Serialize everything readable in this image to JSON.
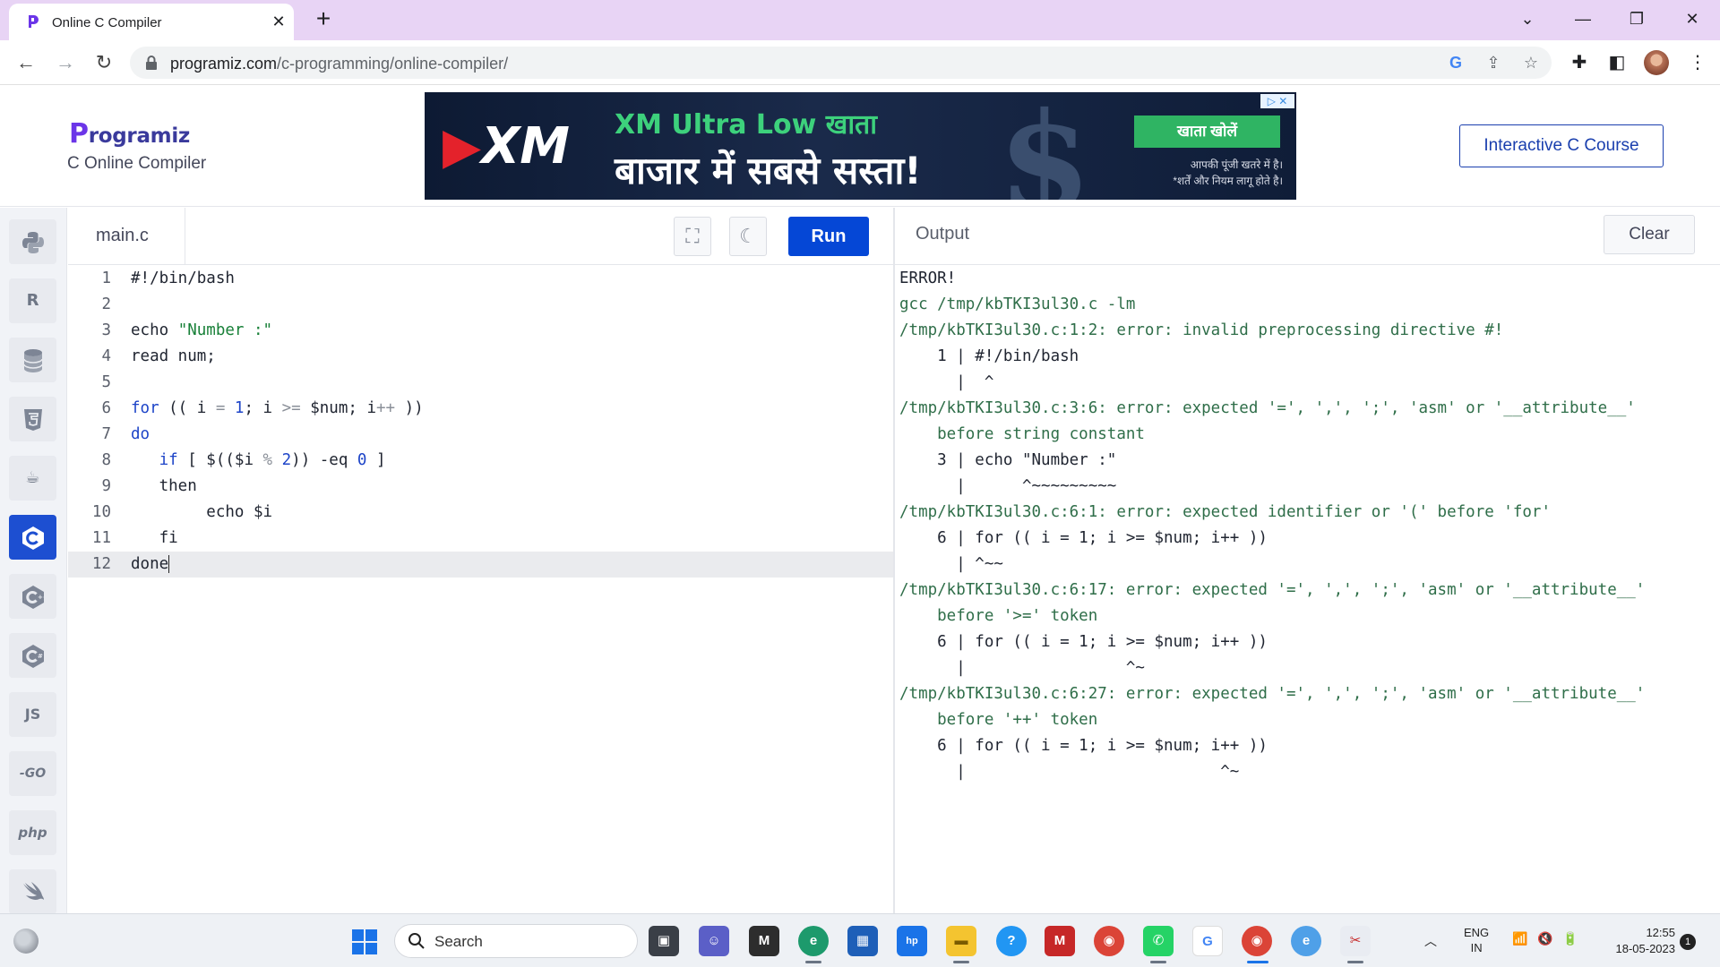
{
  "browser": {
    "tab_title": "Online C Compiler",
    "url_host": "programiz.com",
    "url_path": "/c-programming/online-compiler/"
  },
  "site": {
    "logo_text": "rogramiz",
    "logo_initial": "P",
    "subtitle": "C Online Compiler",
    "course_button": "Interactive C Course"
  },
  "ad": {
    "brand": "XM",
    "line1": "XM Ultra Low खाता",
    "line2": "बाजार में सबसे सस्ता!",
    "cta": "खाता खोलें",
    "note1": "आपकी पूंजी खतरे में है।",
    "note2": "*शर्तें और नियम लागू होते है।"
  },
  "rail": {
    "items": [
      "python",
      "r",
      "sql",
      "html",
      "java",
      "c",
      "c++",
      "c#",
      "JS",
      "GO",
      "php",
      "swift"
    ]
  },
  "editor": {
    "file_name": "main.c",
    "run_label": "Run",
    "line_numbers": [
      "1",
      "2",
      "3",
      "4",
      "5",
      "6",
      "7",
      "8",
      "9",
      "10",
      "11",
      "12"
    ]
  },
  "output": {
    "label": "Output",
    "clear_label": "Clear",
    "lines": [
      "ERROR!",
      "gcc /tmp/kbTKI3ul30.c -lm",
      "/tmp/kbTKI3ul30.c:1:2: error: invalid preprocessing directive #!",
      "    1 | #!/bin/bash",
      "      |  ^",
      "/tmp/kbTKI3ul30.c:3:6: error: expected '=', ',', ';', 'asm' or '__attribute__'",
      "    before string constant",
      "    3 | echo \"Number :\"",
      "      |      ^~~~~~~~~~",
      "/tmp/kbTKI3ul30.c:6:1: error: expected identifier or '(' before 'for'",
      "    6 | for (( i = 1; i >= $num; i++ ))",
      "      | ^~~",
      "/tmp/kbTKI3ul30.c:6:17: error: expected '=', ',', ';', 'asm' or '__attribute__'",
      "    before '>=' token",
      "    6 | for (( i = 1; i >= $num; i++ ))",
      "      |                 ^~",
      "/tmp/kbTKI3ul30.c:6:27: error: expected '=', ',', ';', 'asm' or '__attribute__'",
      "    before '++' token",
      "    6 | for (( i = 1; i >= $num; i++ ))",
      "      |                           ^~"
    ]
  },
  "taskbar": {
    "search_placeholder": "Search",
    "lang_line1": "ENG",
    "lang_line2": "IN",
    "time": "12:55",
    "date": "18-05-2023",
    "notification_count": "1"
  }
}
